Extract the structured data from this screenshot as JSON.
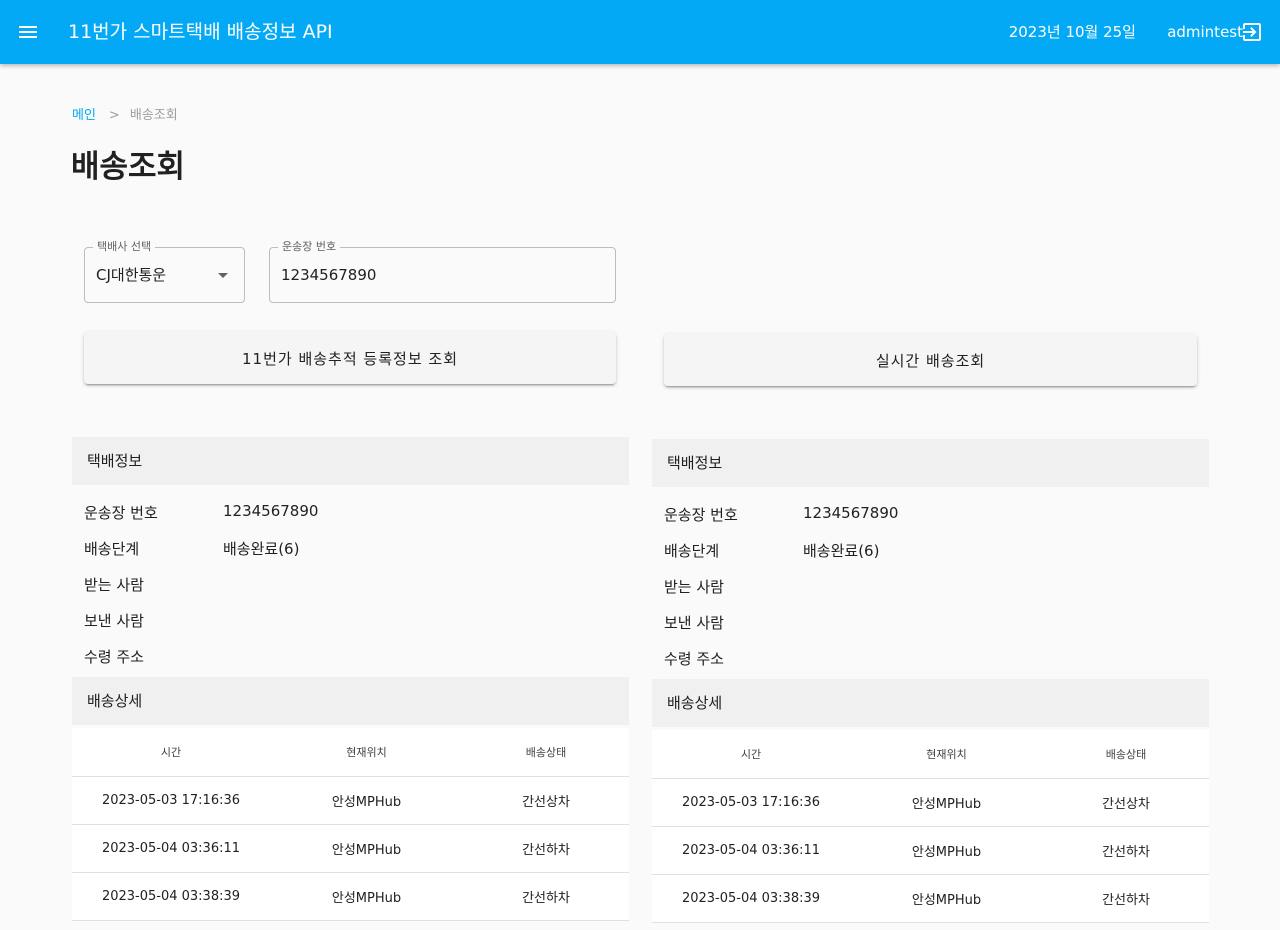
{
  "header": {
    "title": "11번가 스마트택배 배송정보 API",
    "date": "2023년 10월 25일",
    "user": "admintest",
    "menu_icon": "menu-icon",
    "logout_icon": "logout-icon",
    "color": "#03a9f4"
  },
  "breadcrumb": {
    "home": "메인",
    "separator": ">",
    "current": "배송조회"
  },
  "page_title": "배송조회",
  "form": {
    "courier": {
      "legend": "택배사 선택",
      "value": "CJ대한통운"
    },
    "invoice": {
      "legend": "운송장 번호",
      "value": "1234567890"
    }
  },
  "buttons": {
    "registered_lookup": "11번가 배송추적 등록정보 조회",
    "realtime_lookup": "실시간 배송조회"
  },
  "panels": [
    {
      "info_title": "택배정보",
      "info_rows": [
        {
          "label": "운송장 번호",
          "value": "1234567890"
        },
        {
          "label": "배송단계",
          "value": "배송완료(6)"
        },
        {
          "label": "받는 사람",
          "value": ""
        },
        {
          "label": "보낸 사람",
          "value": ""
        },
        {
          "label": "수령 주소",
          "value": ""
        }
      ],
      "detail_title": "배송상세",
      "columns": [
        "시간",
        "현재위치",
        "배송상태"
      ],
      "rows": [
        [
          "2023-05-03 17:16:36",
          "안성MPHub",
          "간선상차"
        ],
        [
          "2023-05-04 03:36:11",
          "안성MPHub",
          "간선하차"
        ],
        [
          "2023-05-04 03:38:39",
          "안성MPHub",
          "간선하차"
        ]
      ]
    },
    {
      "info_title": "택배정보",
      "info_rows": [
        {
          "label": "운송장 번호",
          "value": "1234567890"
        },
        {
          "label": "배송단계",
          "value": "배송완료(6)"
        },
        {
          "label": "받는 사람",
          "value": ""
        },
        {
          "label": "보낸 사람",
          "value": ""
        },
        {
          "label": "수령 주소",
          "value": ""
        }
      ],
      "detail_title": "배송상세",
      "columns": [
        "시간",
        "현재위치",
        "배송상태"
      ],
      "rows": [
        [
          "2023-05-03 17:16:36",
          "안성MPHub",
          "간선상차"
        ],
        [
          "2023-05-04 03:36:11",
          "안성MPHub",
          "간선하차"
        ],
        [
          "2023-05-04 03:38:39",
          "안성MPHub",
          "간선하차"
        ]
      ]
    }
  ]
}
